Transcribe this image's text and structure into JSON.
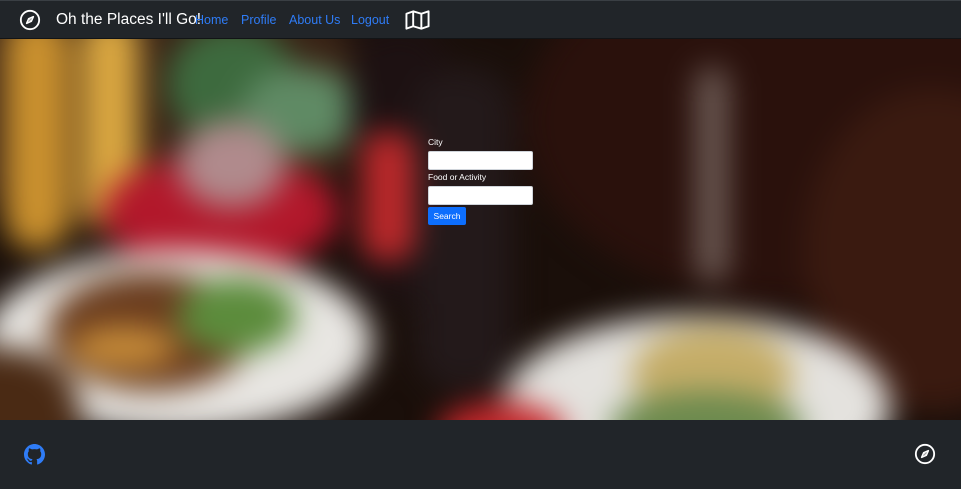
{
  "app": {
    "title": "Oh the Places I'll Go!"
  },
  "navbar": {
    "links": [
      {
        "label": "Home"
      },
      {
        "label": "Profile"
      },
      {
        "label": "About Us"
      },
      {
        "label": "Logout"
      }
    ],
    "brand_icon": "compass-icon",
    "map_icon": "map-icon"
  },
  "search": {
    "city_label": "City",
    "city_value": "",
    "activity_label": "Food or Activity",
    "activity_value": "",
    "button_label": "Search"
  },
  "footer": {
    "left_icon": "github-icon",
    "right_icon": "compass-icon"
  },
  "colors": {
    "navbar_bg": "#212529",
    "link": "#2f7cf6",
    "button": "#0d6efd",
    "footer_bg": "#212529"
  }
}
